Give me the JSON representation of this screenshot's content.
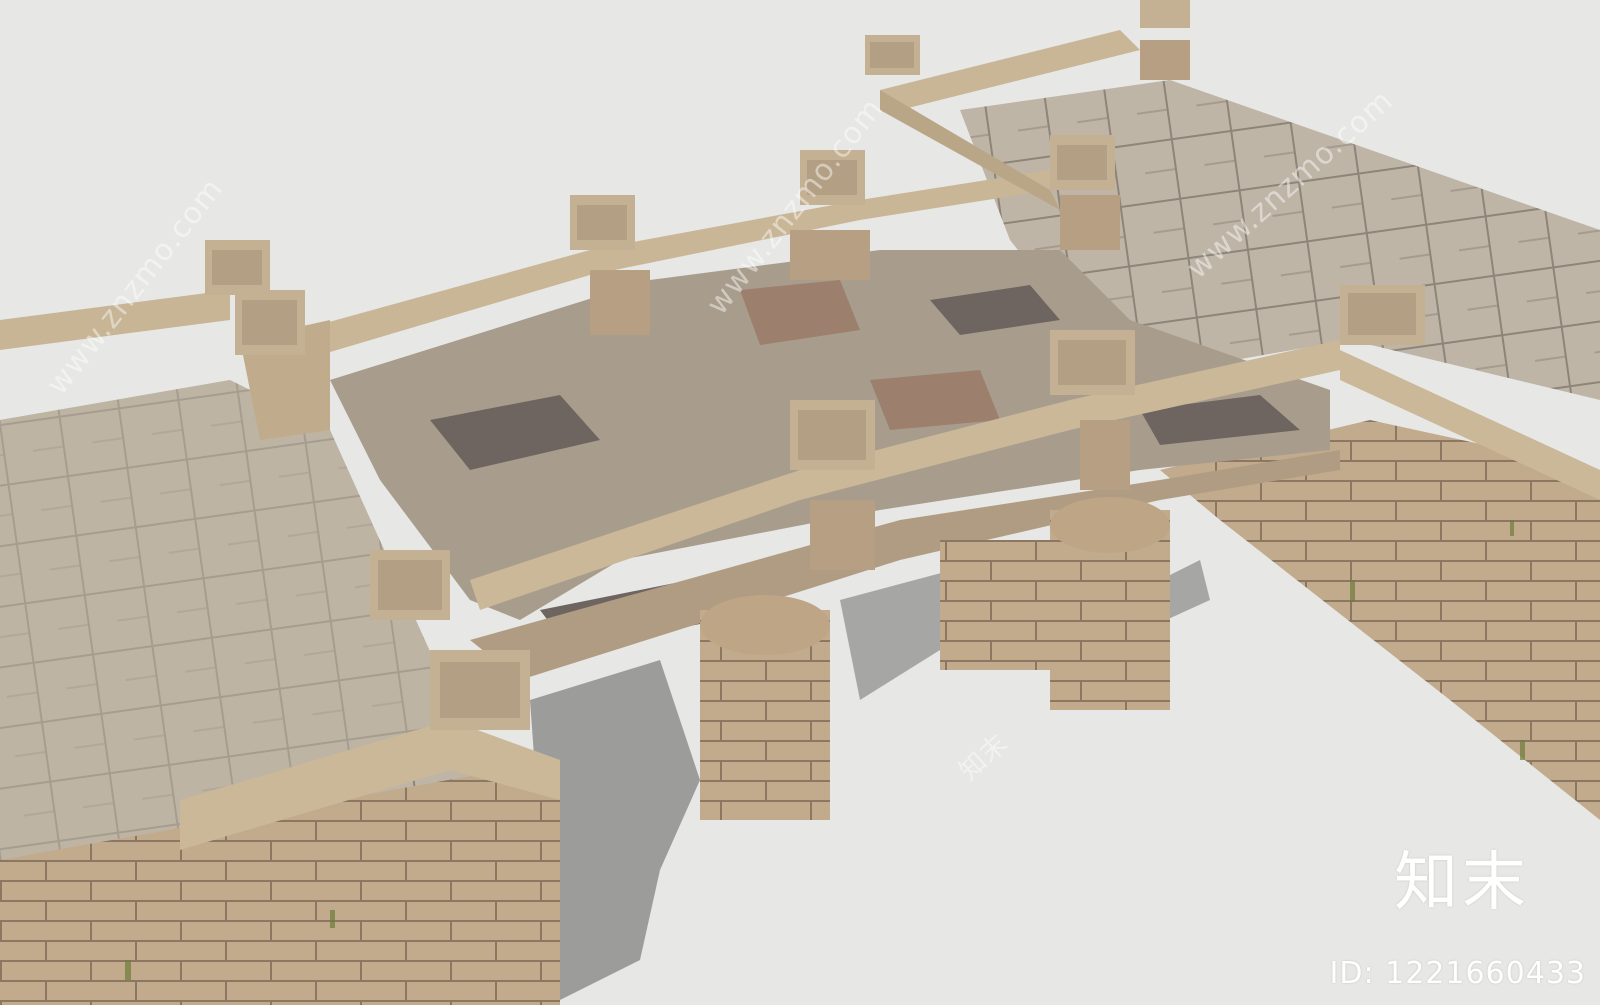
{
  "colors": {
    "background": "#e7e7e5",
    "stone_light": "#c9b79c",
    "stone_mid": "#b8a487",
    "stone_dark": "#8f7c66",
    "paving": "#bdb3a4",
    "paving_dark": "#6f6660",
    "shadow": "#9a9a98",
    "moss": "#6d7a3a"
  },
  "watermark": {
    "site_text": "www.znzmo.com",
    "brand": "知末",
    "id_text": "ID: 1221660433"
  }
}
